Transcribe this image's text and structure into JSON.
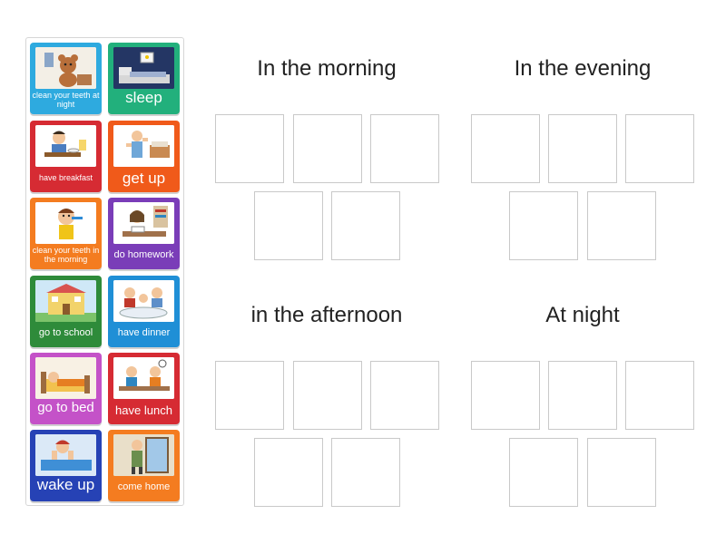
{
  "tiles": [
    {
      "label": "clean your teeth at night",
      "color": "#2eaadf",
      "icon": "teddy-bear-bedroom-icon"
    },
    {
      "label": "sleep",
      "color": "#22b07c",
      "icon": "sleeping-in-bed-icon"
    },
    {
      "label": "have breakfast",
      "color": "#d62b33",
      "icon": "boy-eating-breakfast-icon"
    },
    {
      "label": "get up",
      "color": "#f05a1a",
      "icon": "boy-getting-up-icon"
    },
    {
      "label": "clean your teeth in the morning",
      "color": "#f47c20",
      "icon": "boy-brushing-teeth-icon"
    },
    {
      "label": "do homework",
      "color": "#7a3db8",
      "icon": "girl-doing-homework-icon"
    },
    {
      "label": "go to school",
      "color": "#2e8b3a",
      "icon": "school-building-icon"
    },
    {
      "label": "have dinner",
      "color": "#1f8fd6",
      "icon": "family-dinner-icon"
    },
    {
      "label": "go to bed",
      "color": "#c452c8",
      "icon": "child-in-bed-icon"
    },
    {
      "label": "have lunch",
      "color": "#d62b33",
      "icon": "kids-having-lunch-icon"
    },
    {
      "label": "wake up",
      "color": "#2642b5",
      "icon": "boy-waking-up-icon"
    },
    {
      "label": "come home",
      "color": "#f47c20",
      "icon": "man-coming-home-icon"
    }
  ],
  "groups": [
    {
      "title": "In the morning"
    },
    {
      "title": "In the evening"
    },
    {
      "title": "in the afternoon"
    },
    {
      "title": "At night"
    }
  ]
}
